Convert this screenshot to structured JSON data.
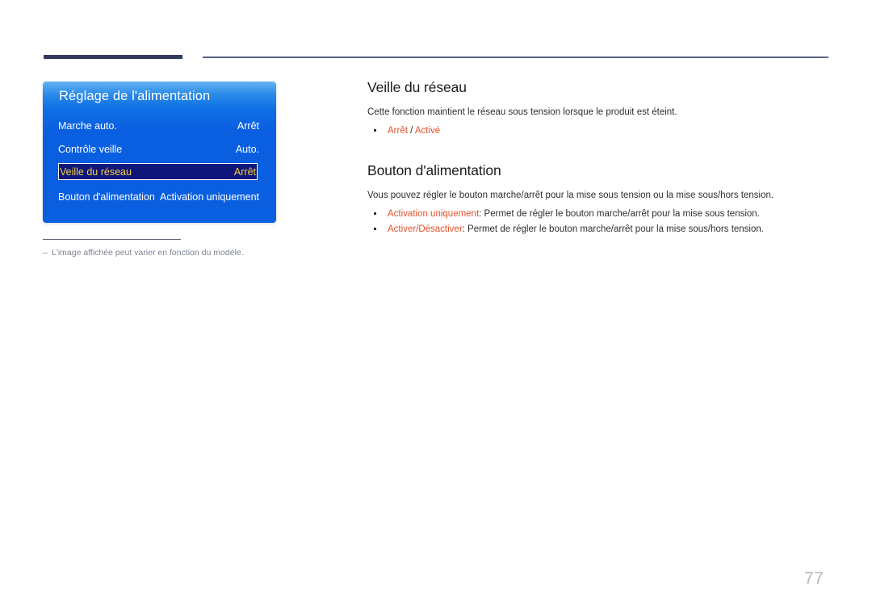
{
  "header": {
    "rule_thick_color": "#323a5e",
    "rule_thin_color": "#5a6080"
  },
  "osd": {
    "title": "Réglage de l'alimentation",
    "accent_highlight_bg": "#10157a",
    "accent_highlight_text": "#f5d23c",
    "rows": [
      {
        "label": "Marche auto.",
        "value": "Arrêt",
        "selected": false
      },
      {
        "label": "Contrôle veille",
        "value": "Auto.",
        "selected": false
      },
      {
        "label": "Veille du réseau",
        "value": "Arrêt",
        "selected": true
      },
      {
        "label": "Bouton d'alimentation",
        "value": "Activation uniquement",
        "selected": false
      }
    ]
  },
  "footnote": {
    "dash": "–",
    "text": "L'image affichée peut varier en fonction du modèle."
  },
  "article": {
    "sections": [
      {
        "heading": "Veille du réseau",
        "intro": "Cette fonction maintient le réseau sous tension lorsque le produit est éteint.",
        "bullets": [
          {
            "term": "Arrêt",
            "separator": " / ",
            "term2": "Activé",
            "description": ""
          }
        ]
      },
      {
        "heading": "Bouton d'alimentation",
        "intro": "Vous pouvez régler le bouton marche/arrêt pour la mise sous tension ou la mise sous/hors tension.",
        "bullets": [
          {
            "term": "Activation uniquement",
            "separator": "",
            "term2": "",
            "description": ": Permet de régler le bouton marche/arrêt pour la mise sous tension."
          },
          {
            "term": "Activer/Désactiver",
            "separator": "",
            "term2": "",
            "description": ": Permet de régler le bouton marche/arrêt pour la mise sous/hors tension."
          }
        ]
      }
    ],
    "highlight_color": "#e2502a"
  },
  "page_number": "77"
}
